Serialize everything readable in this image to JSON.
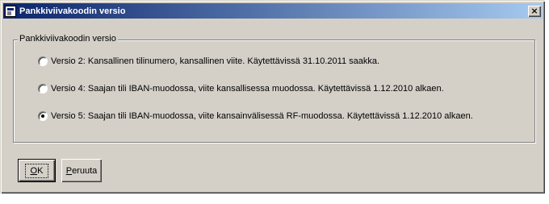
{
  "window": {
    "title": "Pankkiviivakoodin versio",
    "close_glyph": "×"
  },
  "group": {
    "label": "Pankkiviivakoodin versio",
    "options": [
      {
        "label": "Versio 2: Kansallinen tilinumero, kansallinen viite. Käytettävissä 31.10.2011 saakka.",
        "selected": false
      },
      {
        "label": "Versio 4: Saajan tili IBAN-muodossa, viite kansallisessa muodossa. Käytettävissä 1.12.2010 alkaen.",
        "selected": false
      },
      {
        "label": "Versio 5: Saajan tili IBAN-muodossa, viite kansainvälisessä RF-muodossa. Käytettävissä 1.12.2010 alkaen.",
        "selected": true
      }
    ]
  },
  "buttons": {
    "ok_mnemonic": "O",
    "ok_rest": "K",
    "cancel_mnemonic": "P",
    "cancel_rest": "eruuta"
  }
}
